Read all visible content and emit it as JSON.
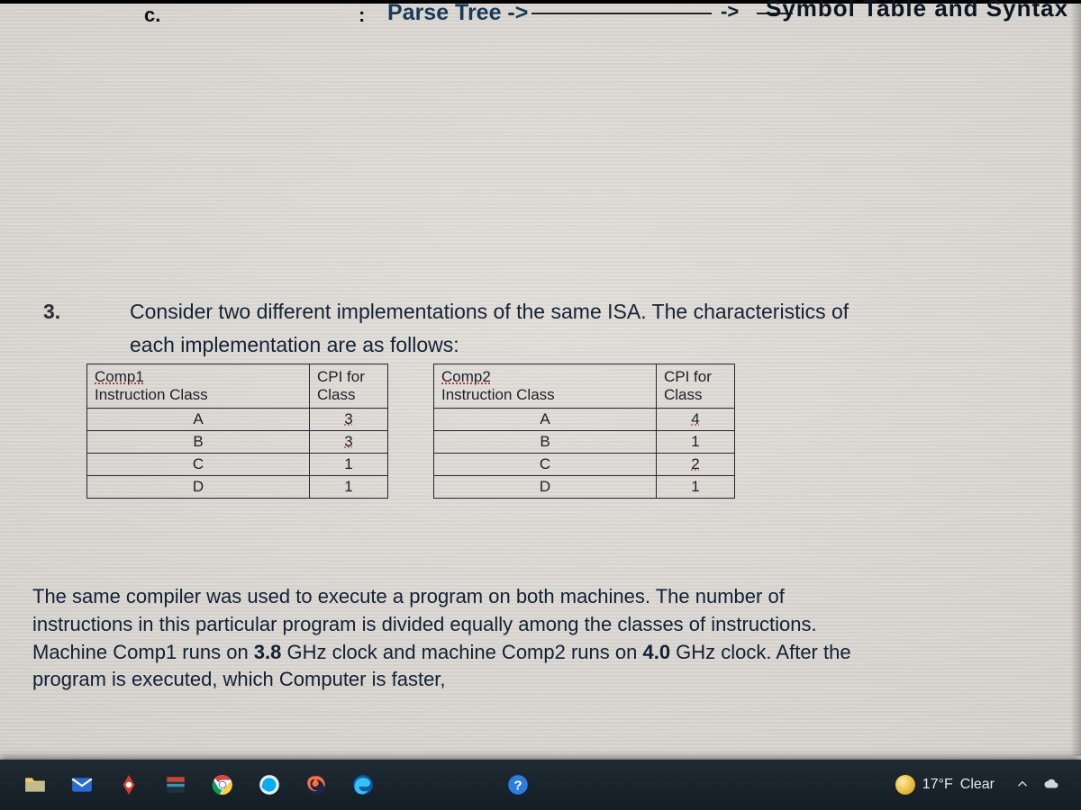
{
  "top": {
    "item_c": "c.",
    "colon": ":",
    "parse_tree": "Parse Tree  ->",
    "arrow": "->",
    "symbol_table": "Symbol Table and Syntax"
  },
  "question": {
    "number": "3.",
    "line1": "Consider two different implementations of the same ISA. The characteristics of",
    "line2": "each implementation are as follows:"
  },
  "tables": {
    "comp1": {
      "title": "Comp1",
      "subtitle": "Instruction Class",
      "cpi_label": "CPI for Class",
      "rows": [
        {
          "cls": "A",
          "cpi": "3"
        },
        {
          "cls": "B",
          "cpi": "3"
        },
        {
          "cls": "C",
          "cpi": "1"
        },
        {
          "cls": "D",
          "cpi": "1"
        }
      ]
    },
    "comp2": {
      "title": "Comp2",
      "subtitle": "Instruction Class",
      "cpi_label": "CPI for Class",
      "rows": [
        {
          "cls": "A",
          "cpi": "4"
        },
        {
          "cls": "B",
          "cpi": "1"
        },
        {
          "cls": "C",
          "cpi": "2"
        },
        {
          "cls": "D",
          "cpi": "1"
        }
      ]
    }
  },
  "paragraph2": {
    "l1": "The same compiler was used to execute a program on both machines. The number of",
    "l2a": "instructions in this particular program is divided equally among the classes of instructions.",
    "l3a": "Machine Comp1 runs on ",
    "l3b": "3.8",
    "l3c": " GHz clock and machine Comp2 runs on ",
    "l3d": "4.0",
    "l3e": "  GHz clock. After the",
    "l4": "program is executed, which Computer  is faster,"
  },
  "taskbar": {
    "weather_temp": "17°F",
    "weather_cond": "Clear"
  }
}
